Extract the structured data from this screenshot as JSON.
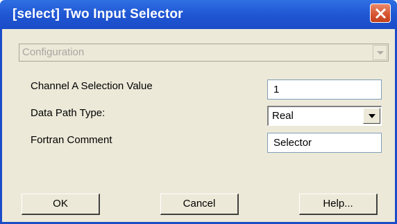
{
  "window": {
    "title": "[select] Two Input Selector"
  },
  "configuration": {
    "value": "Configuration"
  },
  "fields": {
    "channel_a_label": "Channel A Selection Value",
    "channel_a_value": "1",
    "data_path_label": "Data Path Type:",
    "data_path_value": "Real",
    "fortran_label": "Fortran Comment",
    "fortran_value": "Selector"
  },
  "buttons": {
    "ok": "OK",
    "cancel": "Cancel",
    "help": "Help..."
  },
  "icons": {
    "close": "close-icon",
    "config_dropdown": "chevron-down-icon",
    "data_path_dropdown": "chevron-down-icon"
  },
  "colors": {
    "titlebar": "#1f55d2",
    "close_button": "#d5532e",
    "client_background": "#ece9d8",
    "disabled_text": "#a7a6a0"
  }
}
